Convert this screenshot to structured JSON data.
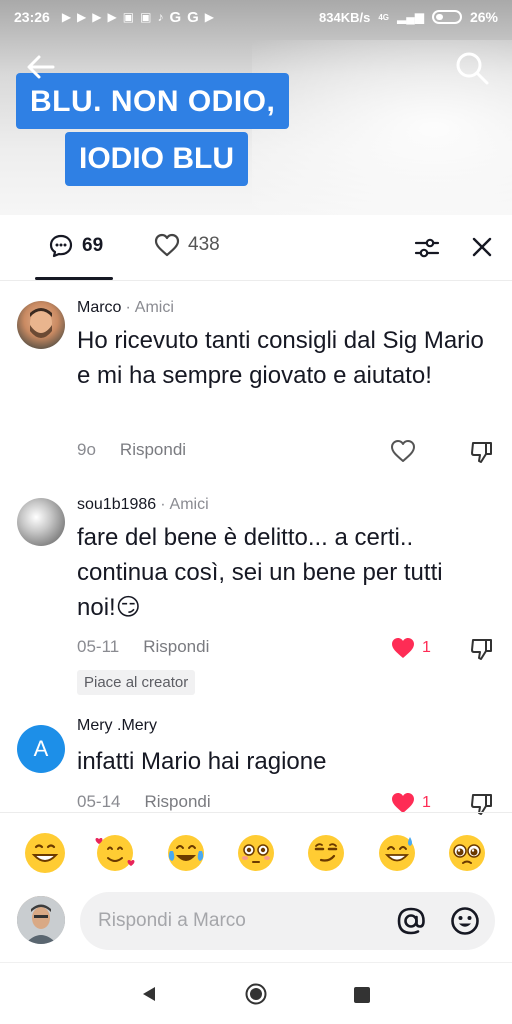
{
  "status_bar": {
    "time": "23:26",
    "network_speed": "834KB/s",
    "network_type": "4G",
    "battery": "26%",
    "notification_icons": [
      "play-icon",
      "play-icon",
      "play-icon",
      "play-icon",
      "photo-icon",
      "photo-icon",
      "tiktok-icon",
      "google-icon",
      "google-icon",
      "youtube-icon"
    ]
  },
  "video": {
    "caption_line1": "BLU. NON ODIO,",
    "caption_line2": "IODIO BLU",
    "caption_bg": "#2f80e4"
  },
  "tabs": {
    "comments_count": "69",
    "likes_count": "438"
  },
  "comments": [
    {
      "author": "Marco",
      "relation": "Amici",
      "text": "Ho ricevuto tanti consigli dal Sig Mario e mi ha sempre giovato e aiutato!",
      "time": "9o",
      "reply": "Rispondi",
      "likes": "",
      "liked": false
    },
    {
      "author": "sou1b1986",
      "relation": "Amici",
      "text": "fare del bene è delitto... a certi.. continua così, sei un bene per tutti noi!😏",
      "time": "05-11",
      "reply": "Rispondi",
      "likes": "1",
      "liked": true,
      "badge": "Piace al creator"
    },
    {
      "author": "Mery .Mery",
      "avatar_letter": "A",
      "relation": "",
      "text": "infatti Mario hai ragione",
      "time": "05-14",
      "reply": "Rispondi",
      "likes": "1",
      "liked": true
    }
  ],
  "emojis": [
    "😁",
    "🥰",
    "😂",
    "😳",
    "😏",
    "😅",
    "🥺"
  ],
  "input": {
    "placeholder": "Rispondi a Marco"
  },
  "colors": {
    "accent_like": "#fe2c55",
    "avatar_blue": "#1d8fe8"
  }
}
